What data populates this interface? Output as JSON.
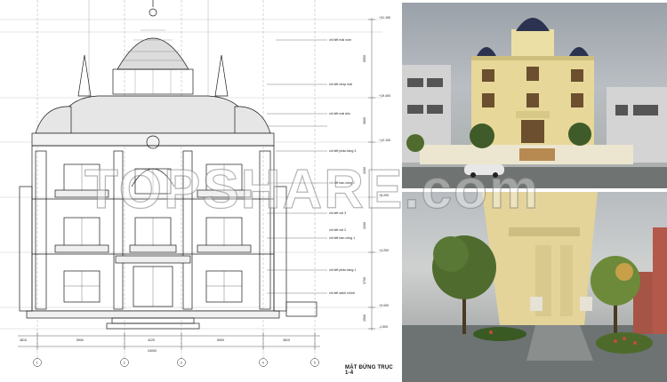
{
  "drawing": {
    "sheet_title": "MẶT ĐỨNG TRỤC 1-4",
    "grid_axes": [
      "1",
      "2",
      "3",
      "4",
      "5"
    ],
    "bottom_dims": [
      "3810",
      "5900",
      "4220",
      "5900",
      "3810"
    ],
    "total_dim": "24000",
    "side_dims": [
      "5550",
      "3800",
      "3200",
      "3200",
      "3700",
      "1500"
    ],
    "elevation_marks": [
      "+31.150",
      "+19.400",
      "+12.100",
      "+8.200",
      "+4.200",
      "+0.000",
      "-1.500"
    ],
    "callouts": [
      "chi tiết mái vòm",
      "chi tiết chóp mái",
      "chi tiết mái dốc",
      "chi tiết phào tầng 3",
      "chi tiết ban công 2",
      "chi tiết cột 3",
      "chi tiết cột 2",
      "chi tiết ban công 1",
      "chi tiết phào tầng 1",
      "chi tiết sảnh chính"
    ]
  },
  "watermark": "TOPSHARE.com",
  "colors": {
    "line": "#1a1a1a",
    "facade": "#e8d79a",
    "dome": "#2c3350",
    "sky": "#b9bec3",
    "tree": "#4f6b2e"
  }
}
